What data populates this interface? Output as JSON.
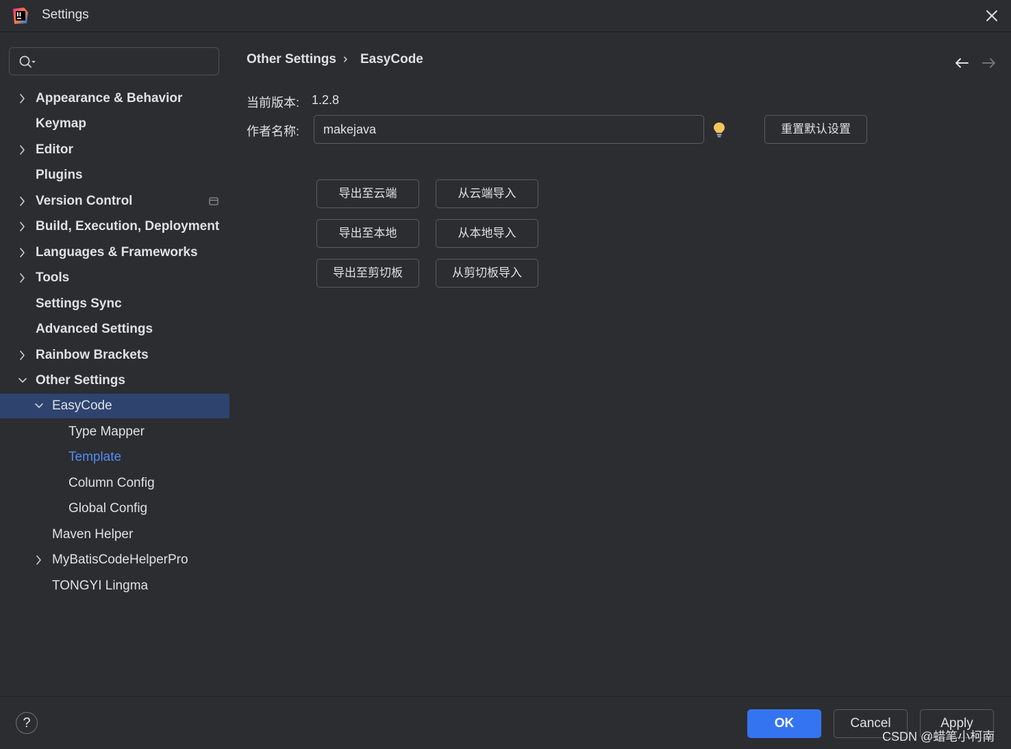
{
  "window": {
    "title": "Settings",
    "logo_icon": "intellij-idea-logo"
  },
  "search": {
    "value": "",
    "icon": "search-icon"
  },
  "sidebar": {
    "items": [
      {
        "label": "Appearance & Behavior",
        "expandable": true,
        "expanded": false
      },
      {
        "label": "Keymap",
        "expandable": false
      },
      {
        "label": "Editor",
        "expandable": true,
        "expanded": false
      },
      {
        "label": "Plugins",
        "expandable": false
      },
      {
        "label": "Version Control",
        "expandable": true,
        "expanded": false
      },
      {
        "label": "Build, Execution, Deployment",
        "expandable": true,
        "expanded": false
      },
      {
        "label": "Languages & Frameworks",
        "expandable": true,
        "expanded": false
      },
      {
        "label": "Tools",
        "expandable": true,
        "expanded": false
      },
      {
        "label": "Settings Sync",
        "expandable": false
      },
      {
        "label": "Advanced Settings",
        "expandable": false
      },
      {
        "label": "Rainbow Brackets",
        "expandable": true,
        "expanded": false
      },
      {
        "label": "Other Settings",
        "expandable": true,
        "expanded": true
      },
      {
        "label": "EasyCode",
        "expandable": true,
        "expanded": true,
        "selected": true
      },
      {
        "label": "Type Mapper"
      },
      {
        "label": "Template",
        "link_color": "#548af7"
      },
      {
        "label": "Column Config"
      },
      {
        "label": "Global Config"
      },
      {
        "label": "Maven Helper"
      },
      {
        "label": "MyBatisCodeHelperPro",
        "expandable": true,
        "expanded": false
      },
      {
        "label": "TONGYI Lingma"
      }
    ]
  },
  "breadcrumb": {
    "parent": "Other Settings",
    "separator": "›",
    "current": "EasyCode"
  },
  "form": {
    "version_label": "当前版本:",
    "version_value": "1.2.8",
    "author_label": "作者名称:",
    "author_value": "makejava",
    "reset_label": "重置默认设置"
  },
  "actions": {
    "export_cloud": "导出至云端",
    "import_cloud": "从云端导入",
    "export_local": "导出至本地",
    "import_local": "从本地导入",
    "export_clipboard": "导出至剪切板",
    "import_clipboard": "从剪切板导入"
  },
  "footer": {
    "help": "?",
    "ok": "OK",
    "cancel": "Cancel",
    "apply": "Apply"
  },
  "watermark": "CSDN @蜡笔小柯南",
  "colors": {
    "background": "#2b2d30",
    "selection": "#2e436e",
    "accent": "#3574f0",
    "link": "#548af7",
    "bulb": "#f2c55c"
  }
}
